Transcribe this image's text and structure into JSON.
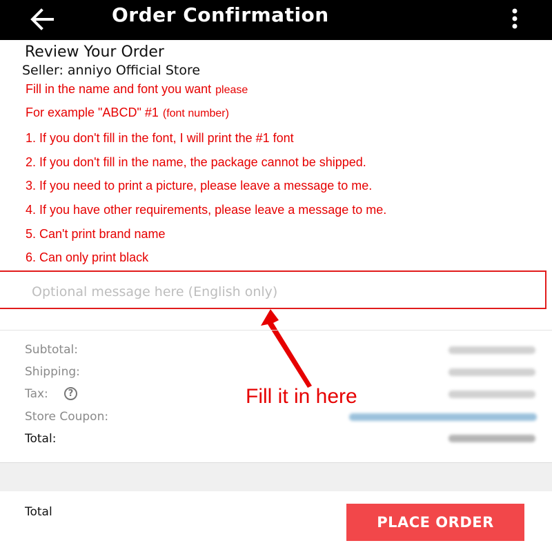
{
  "app_bar": {
    "title": "Order Confirmation",
    "back_icon": "arrow-left-icon",
    "menu_icon": "more-vertical-icon"
  },
  "review": {
    "heading": "Review Your Order",
    "seller": "Seller: anniyo Official Store",
    "notes": [
      {
        "text": "Fill in the name and font you want",
        "small": "please"
      },
      {
        "text": "For example \"ABCD\"  #1",
        "small": "(font number)"
      },
      {
        "text": "1. If you don't fill in the font, I will print the #1 font"
      },
      {
        "text": "2. If you don't fill in the name, the package cannot be shipped."
      },
      {
        "text": "3. If you need to print a picture, please leave a message to me."
      },
      {
        "text": "4. If you have other requirements, please leave a message to me."
      },
      {
        "text": "5. Can't print brand name"
      },
      {
        "text": "6. Can only print black"
      }
    ]
  },
  "message": {
    "placeholder": "Optional message here (English only)"
  },
  "annotation": {
    "text": "Fill it in here"
  },
  "summary": {
    "subtotal_label": "Subtotal:",
    "shipping_label": "Shipping:",
    "tax_label": "Tax:",
    "tax_help_icon": "help-circle-icon",
    "coupon_label": "Store Coupon:",
    "total_label": "Total:"
  },
  "bottom": {
    "total_label": "Total",
    "place_order_label": "PLACE ORDER"
  },
  "colors": {
    "app_bar": "#000000",
    "note_red": "#e60000",
    "highlight_border": "#e11b1b",
    "place_order_bg": "#f2474a"
  }
}
